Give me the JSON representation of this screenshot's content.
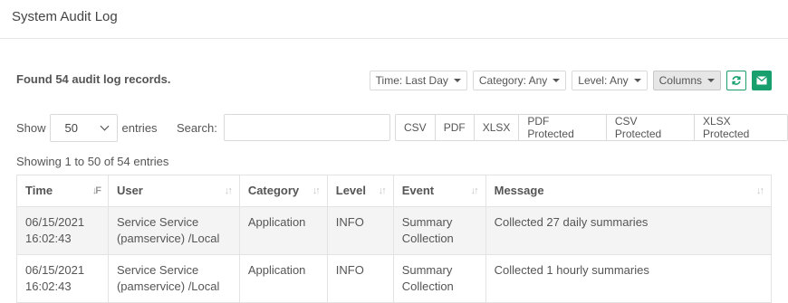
{
  "header": {
    "title": "System Audit Log"
  },
  "summary": {
    "found": "Found 54 audit log records."
  },
  "filters": {
    "time": "Time: Last Day",
    "category": "Category: Any",
    "level": "Level: Any",
    "columns": "Columns"
  },
  "icons": {
    "refresh": "refresh-icon",
    "email": "envelope-icon"
  },
  "colors": {
    "accent": "#17a06e"
  },
  "length": {
    "show": "Show",
    "value": "50",
    "entries": "entries"
  },
  "search": {
    "label": "Search:",
    "value": ""
  },
  "exports": [
    "CSV",
    "PDF",
    "XLSX",
    "PDF Protected",
    "CSV Protected",
    "XLSX Protected"
  ],
  "table": {
    "info": "Showing 1 to 50 of 54 entries",
    "columns": [
      "Time",
      "User",
      "Category",
      "Level",
      "Event",
      "Message"
    ],
    "rows": [
      {
        "time": [
          "06/15/2021",
          "16:02:43"
        ],
        "user": [
          "Service Service",
          "(pamservice) /Local"
        ],
        "category": "Application",
        "level": "INFO",
        "event": [
          "Summary",
          "Collection"
        ],
        "message": "Collected 27 daily summaries"
      },
      {
        "time": [
          "06/15/2021",
          "16:02:43"
        ],
        "user": [
          "Service Service",
          "(pamservice) /Local"
        ],
        "category": "Application",
        "level": "INFO",
        "event": [
          "Summary",
          "Collection"
        ],
        "message": "Collected 1 hourly summaries"
      }
    ]
  }
}
